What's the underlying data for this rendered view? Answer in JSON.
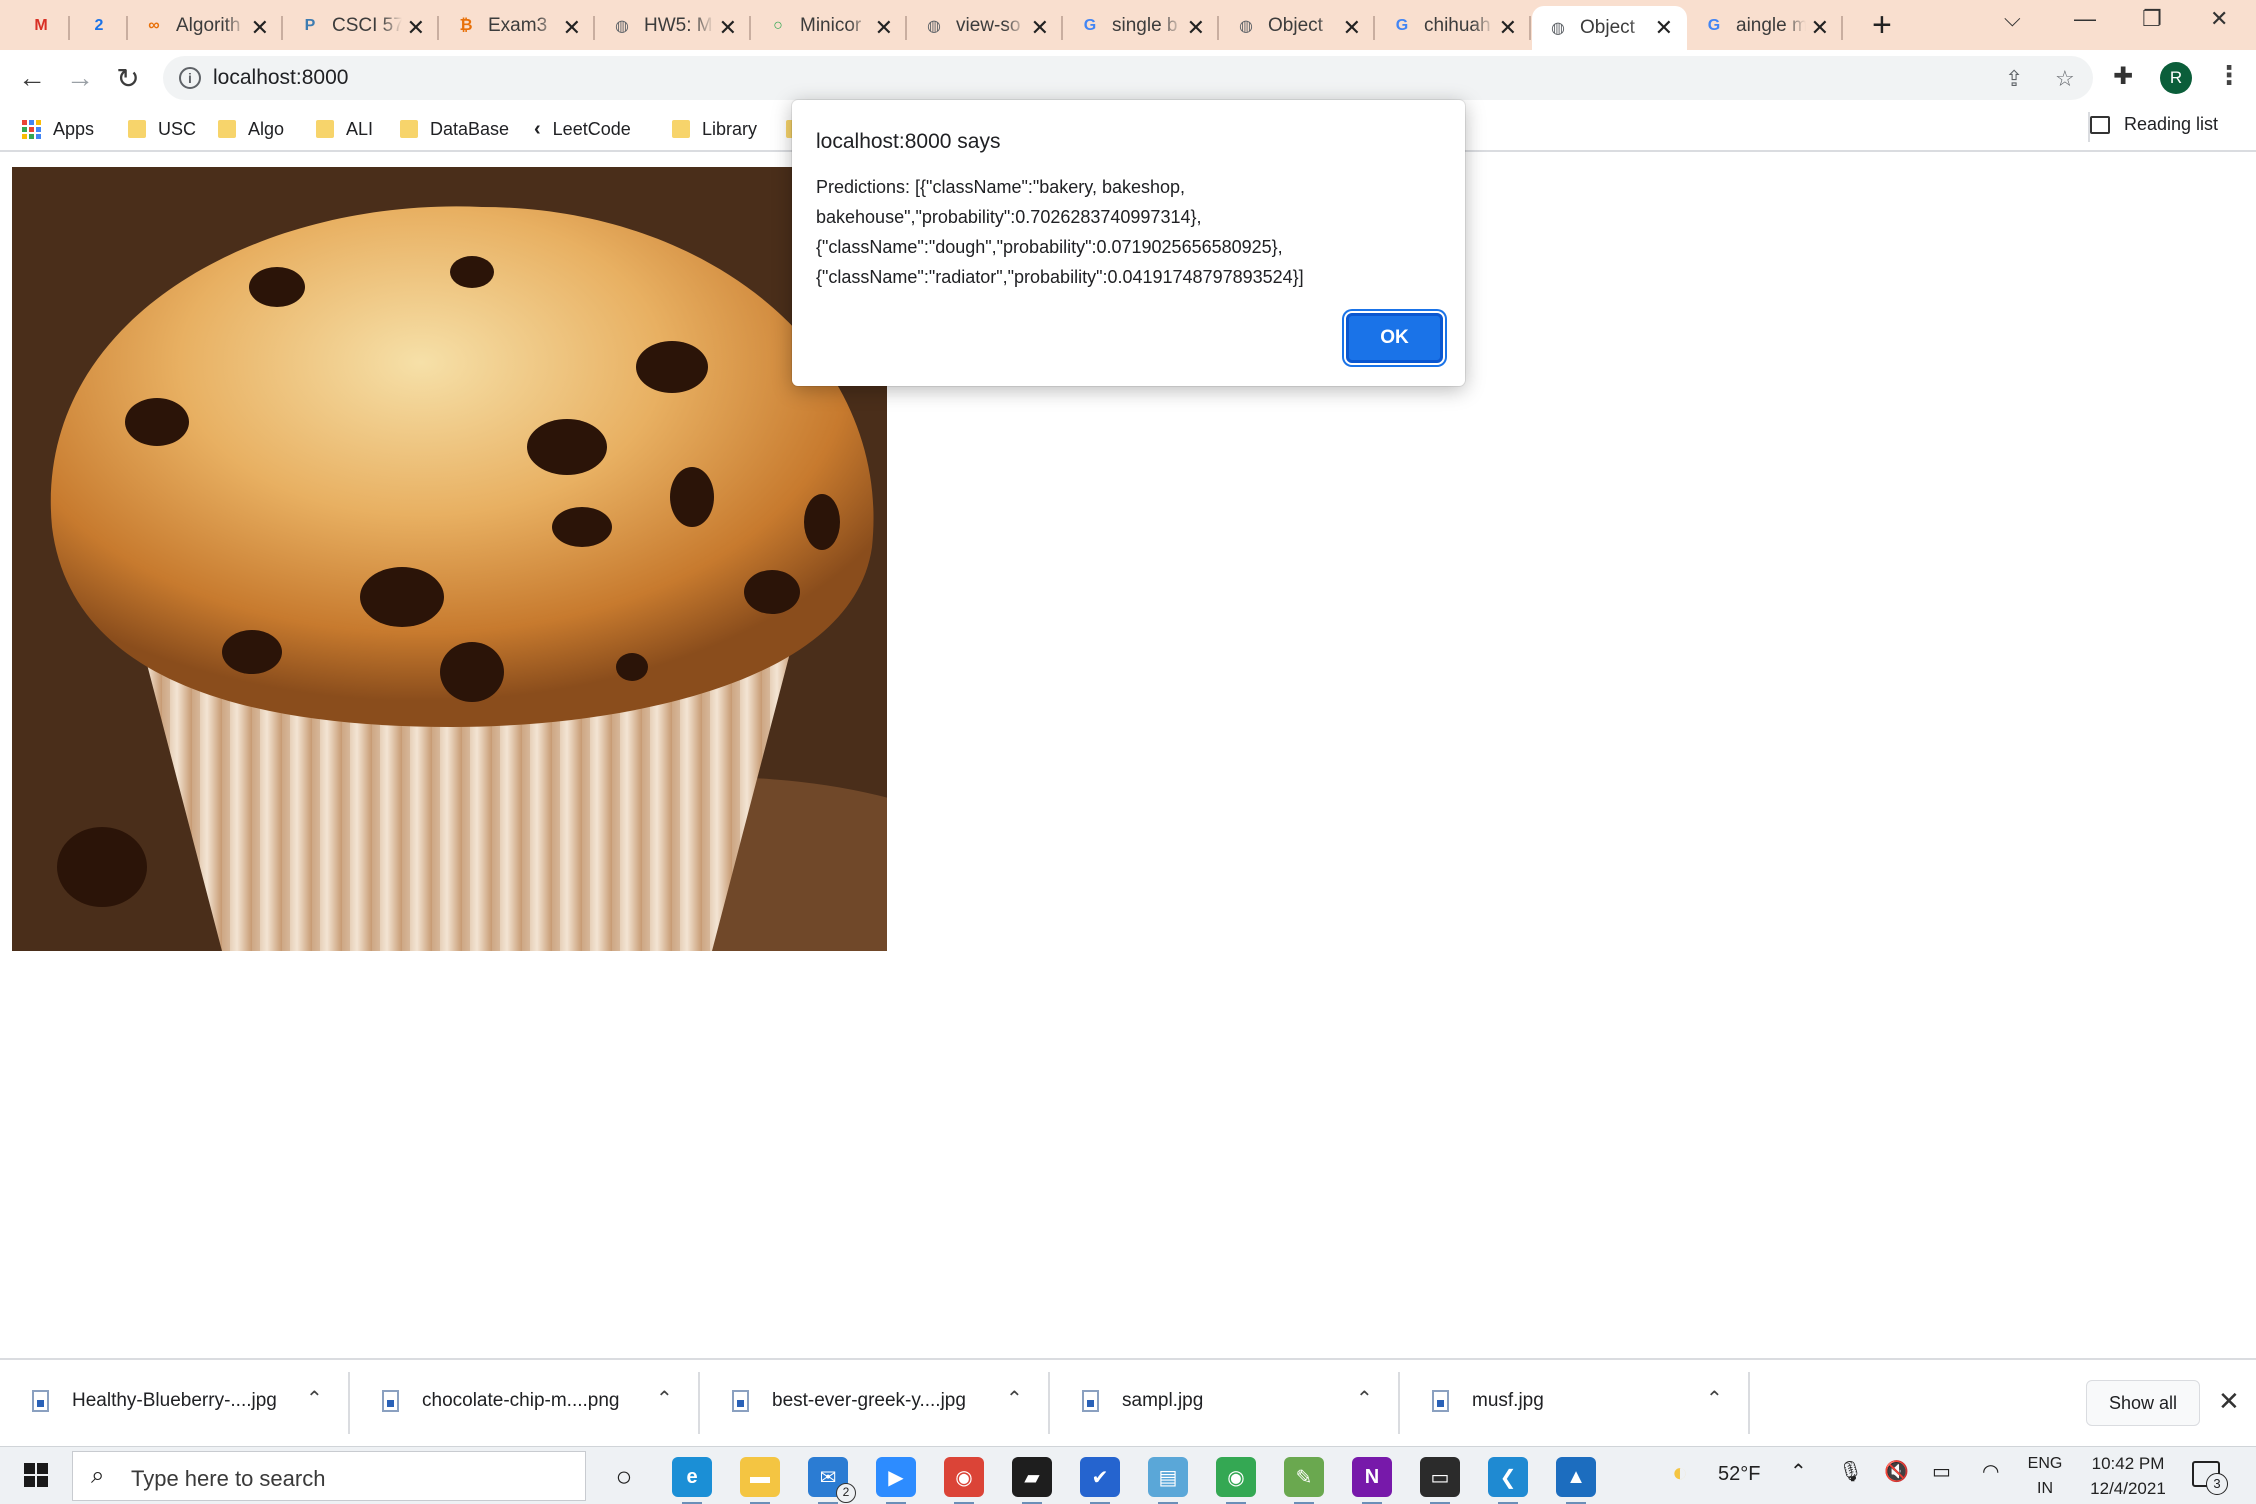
{
  "tabs": [
    {
      "title": "",
      "icon": "gmail-icon",
      "color": "#d93025",
      "glyph": "M"
    },
    {
      "title": "",
      "icon": "calendar-icon",
      "color": "#1a73e8",
      "glyph": "2"
    },
    {
      "title": "Algorith",
      "icon": "coursera-icon",
      "color": "#e8710a",
      "glyph": "∞"
    },
    {
      "title": "CSCI 57",
      "icon": "piazza-icon",
      "color": "#3e7cb1",
      "glyph": "P"
    },
    {
      "title": "Exam3",
      "icon": "exam-icon",
      "color": "#e8710a",
      "glyph": "₿"
    },
    {
      "title": "HW5: M",
      "icon": "globe-icon",
      "color": "#5f6368",
      "glyph": "◍"
    },
    {
      "title": "Minicor",
      "icon": "loading-icon",
      "color": "#34a853",
      "glyph": "○"
    },
    {
      "title": "view-so",
      "icon": "globe-icon",
      "color": "#5f6368",
      "glyph": "◍"
    },
    {
      "title": "single b",
      "icon": "google-icon",
      "color": "#4285f4",
      "glyph": "G"
    },
    {
      "title": "Object",
      "icon": "globe-icon",
      "color": "#5f6368",
      "glyph": "◍"
    },
    {
      "title": "chihuah",
      "icon": "google-icon",
      "color": "#4285f4",
      "glyph": "G"
    },
    {
      "title": "Object",
      "icon": "globe-icon",
      "color": "#5f6368",
      "glyph": "◍",
      "active": true
    },
    {
      "title": "aingle m",
      "icon": "google-icon",
      "color": "#4285f4",
      "glyph": "G"
    }
  ],
  "omnibox": {
    "url": "localhost:8000"
  },
  "profile_initial": "R",
  "bookmarks": [
    {
      "label": "Apps",
      "type": "apps"
    },
    {
      "label": "USC",
      "type": "folder"
    },
    {
      "label": "Algo",
      "type": "folder"
    },
    {
      "label": "ALI",
      "type": "folder"
    },
    {
      "label": "DataBase",
      "type": "folder"
    },
    {
      "label": "LeetCode",
      "type": "leetcode"
    },
    {
      "label": "Library",
      "type": "folder"
    }
  ],
  "reading_list": "Reading list",
  "dialog": {
    "title": "localhost:8000 says",
    "message": "Predictions: [{\"className\":\"bakery, bakeshop, bakehouse\",\"probability\":0.7026283740997314}, {\"className\":\"dough\",\"probability\":0.0719025656580925}, {\"className\":\"radiator\",\"probability\":0.04191748797893524}]",
    "ok_label": "OK"
  },
  "downloads": [
    {
      "name": "Healthy-Blueberry-....jpg"
    },
    {
      "name": "chocolate-chip-m....png"
    },
    {
      "name": "best-ever-greek-y....jpg"
    },
    {
      "name": "sampl.jpg"
    },
    {
      "name": "musf.jpg"
    }
  ],
  "show_all_label": "Show all",
  "taskbar": {
    "search_placeholder": "Type here to search",
    "mail_badge": "2",
    "weather": "52°F",
    "lang": "ENG",
    "region": "IN",
    "time": "10:42 PM",
    "date": "12/4/2021",
    "notification_count": "3",
    "apps": [
      {
        "icon": "task-view-icon",
        "color": "#eef1f4"
      },
      {
        "icon": "edge-icon",
        "color": "#1b8fd6"
      },
      {
        "icon": "file-explorer-icon",
        "color": "#f4c542"
      },
      {
        "icon": "mail-icon",
        "color": "#2b7cd3"
      },
      {
        "icon": "zoom-icon",
        "color": "#2d8cff"
      },
      {
        "icon": "chrome-dev-icon",
        "color": "#db4437"
      },
      {
        "icon": "sticky-notes-icon",
        "color": "#1e1e1e"
      },
      {
        "icon": "todo-icon",
        "color": "#2564cf"
      },
      {
        "icon": "notepad-icon",
        "color": "#5aa7d8"
      },
      {
        "icon": "chrome-icon",
        "color": "#34a853"
      },
      {
        "icon": "sketch-icon",
        "color": "#6aa84f"
      },
      {
        "icon": "onenote-icon",
        "color": "#7719aa"
      },
      {
        "icon": "terminal-icon",
        "color": "#2b2b2b"
      },
      {
        "icon": "vscode-icon",
        "color": "#1f8ad2"
      },
      {
        "icon": "photos-icon",
        "color": "#1c6dbf"
      }
    ]
  }
}
